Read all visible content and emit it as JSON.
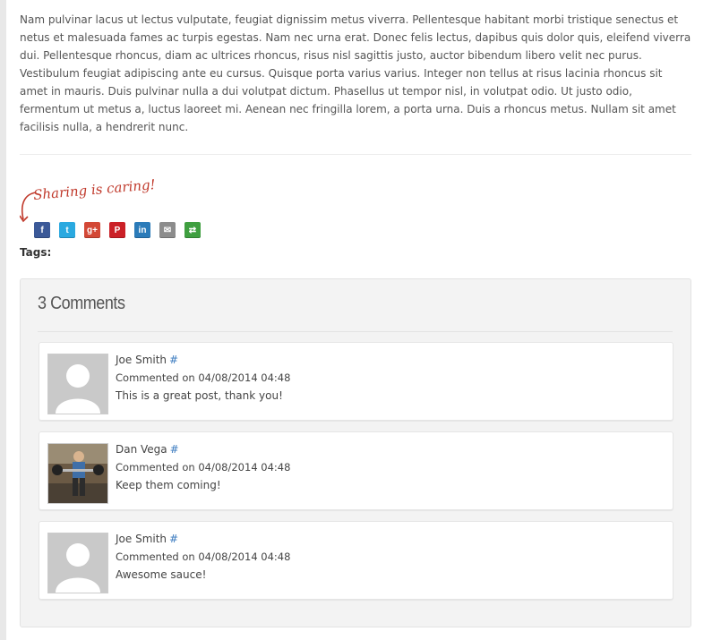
{
  "post": {
    "paragraph": "Nam pulvinar lacus ut lectus vulputate, feugiat dignissim metus viverra. Pellentesque habitant morbi tristique senectus et netus et malesuada fames ac turpis egestas. Nam nec urna erat. Donec felis lectus, dapibus quis dolor quis, eleifend viverra dui. Pellentesque rhoncus, diam ac ultrices rhoncus, risus nisl sagittis justo, auctor bibendum libero velit nec purus. Vestibulum feugiat adipiscing ante eu cursus. Quisque porta varius varius. Integer non tellus at risus lacinia rhoncus sit amet in mauris. Duis pulvinar nulla a dui volutpat dictum. Phasellus ut tempor nisl, in volutpat odio. Ut justo odio, fermentum ut metus a, luctus laoreet mi. Aenean nec fringilla lorem, a porta urna. Duis a rhoncus metus. Nullam sit amet facilisis nulla, a hendrerit nunc."
  },
  "sharing": {
    "label": "Sharing is caring!",
    "icons": [
      {
        "name": "facebook-icon",
        "glyph": "f",
        "color": "#3b5998"
      },
      {
        "name": "twitter-icon",
        "glyph": "t",
        "color": "#2aa9e0"
      },
      {
        "name": "google-plus-icon",
        "glyph": "g+",
        "color": "#d34836"
      },
      {
        "name": "pinterest-icon",
        "glyph": "P",
        "color": "#cb2027"
      },
      {
        "name": "linkedin-icon",
        "glyph": "in",
        "color": "#2b7bb9"
      },
      {
        "name": "email-icon",
        "glyph": "✉",
        "color": "#8c8c8c"
      },
      {
        "name": "more-sharing-icon",
        "glyph": "⇄",
        "color": "#3f9f40"
      }
    ]
  },
  "tags": {
    "label": "Tags:"
  },
  "comments": {
    "title": "3 Comments",
    "items": [
      {
        "author": "Joe Smith",
        "hash": "#",
        "date": "Commented on 04/08/2014 04:48",
        "body": "This is a great post, thank you!",
        "avatar": "default"
      },
      {
        "author": "Dan Vega",
        "hash": "#",
        "date": "Commented on 04/08/2014 04:48",
        "body": "Keep them coming!",
        "avatar": "photo"
      },
      {
        "author": "Joe Smith",
        "hash": "#",
        "date": "Commented on 04/08/2014 04:48",
        "body": "Awesome sauce!",
        "avatar": "default"
      }
    ]
  }
}
